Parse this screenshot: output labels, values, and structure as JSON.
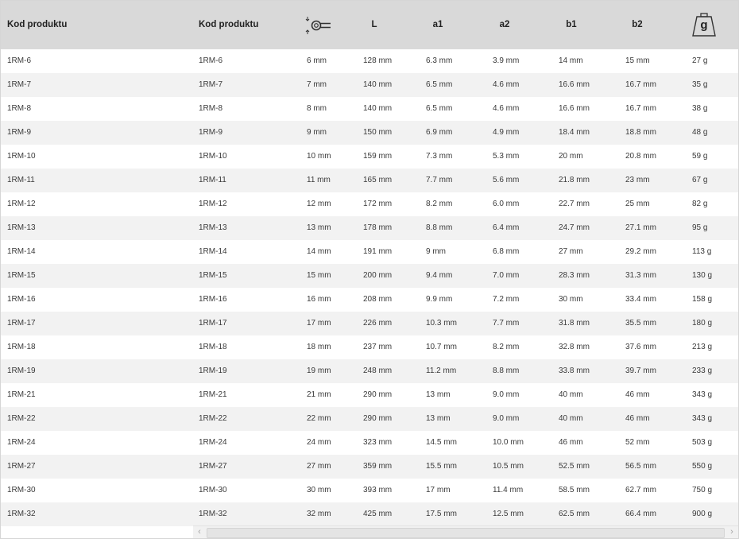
{
  "table": {
    "headers": {
      "code": "Kod produktu",
      "code2": "Kod produktu",
      "size_icon": "wrench-size-icon",
      "L": "L",
      "a1": "a1",
      "a2": "a2",
      "b1": "b1",
      "b2": "b2",
      "weight_icon": "weight-icon",
      "weight_letter": "g"
    },
    "rows": [
      [
        "1RM-6",
        "1RM-6",
        "6 mm",
        "128 mm",
        "6.3 mm",
        "3.9 mm",
        "14 mm",
        "15 mm",
        "27 g"
      ],
      [
        "1RM-7",
        "1RM-7",
        "7 mm",
        "140 mm",
        "6.5 mm",
        "4.6 mm",
        "16.6 mm",
        "16.7 mm",
        "35 g"
      ],
      [
        "1RM-8",
        "1RM-8",
        "8 mm",
        "140 mm",
        "6.5 mm",
        "4.6 mm",
        "16.6 mm",
        "16.7 mm",
        "38 g"
      ],
      [
        "1RM-9",
        "1RM-9",
        "9 mm",
        "150 mm",
        "6.9 mm",
        "4.9 mm",
        "18.4 mm",
        "18.8 mm",
        "48 g"
      ],
      [
        "1RM-10",
        "1RM-10",
        "10 mm",
        "159 mm",
        "7.3 mm",
        "5.3 mm",
        "20 mm",
        "20.8 mm",
        "59 g"
      ],
      [
        "1RM-11",
        "1RM-11",
        "11 mm",
        "165 mm",
        "7.7 mm",
        "5.6 mm",
        "21.8 mm",
        "23 mm",
        "67 g"
      ],
      [
        "1RM-12",
        "1RM-12",
        "12 mm",
        "172 mm",
        "8.2 mm",
        "6.0 mm",
        "22.7 mm",
        "25 mm",
        "82 g"
      ],
      [
        "1RM-13",
        "1RM-13",
        "13 mm",
        "178 mm",
        "8.8 mm",
        "6.4 mm",
        "24.7 mm",
        "27.1 mm",
        "95 g"
      ],
      [
        "1RM-14",
        "1RM-14",
        "14 mm",
        "191 mm",
        "9 mm",
        "6.8 mm",
        "27 mm",
        "29.2 mm",
        "113 g"
      ],
      [
        "1RM-15",
        "1RM-15",
        "15 mm",
        "200 mm",
        "9.4 mm",
        "7.0 mm",
        "28.3 mm",
        "31.3 mm",
        "130 g"
      ],
      [
        "1RM-16",
        "1RM-16",
        "16 mm",
        "208 mm",
        "9.9 mm",
        "7.2 mm",
        "30 mm",
        "33.4 mm",
        "158 g"
      ],
      [
        "1RM-17",
        "1RM-17",
        "17 mm",
        "226 mm",
        "10.3 mm",
        "7.7 mm",
        "31.8 mm",
        "35.5 mm",
        "180 g"
      ],
      [
        "1RM-18",
        "1RM-18",
        "18 mm",
        "237 mm",
        "10.7 mm",
        "8.2 mm",
        "32.8 mm",
        "37.6 mm",
        "213 g"
      ],
      [
        "1RM-19",
        "1RM-19",
        "19 mm",
        "248 mm",
        "11.2 mm",
        "8.8 mm",
        "33.8 mm",
        "39.7 mm",
        "233 g"
      ],
      [
        "1RM-21",
        "1RM-21",
        "21 mm",
        "290 mm",
        "13 mm",
        "9.0 mm",
        "40 mm",
        "46 mm",
        "343 g"
      ],
      [
        "1RM-22",
        "1RM-22",
        "22 mm",
        "290 mm",
        "13 mm",
        "9.0 mm",
        "40 mm",
        "46 mm",
        "343 g"
      ],
      [
        "1RM-24",
        "1RM-24",
        "24 mm",
        "323 mm",
        "14.5 mm",
        "10.0 mm",
        "46 mm",
        "52 mm",
        "503 g"
      ],
      [
        "1RM-27",
        "1RM-27",
        "27 mm",
        "359 mm",
        "15.5 mm",
        "10.5 mm",
        "52.5 mm",
        "56.5 mm",
        "550 g"
      ],
      [
        "1RM-30",
        "1RM-30",
        "30 mm",
        "393 mm",
        "17 mm",
        "11.4 mm",
        "58.5 mm",
        "62.7 mm",
        "750 g"
      ],
      [
        "1RM-32",
        "1RM-32",
        "32 mm",
        "425 mm",
        "17.5 mm",
        "12.5 mm",
        "62.5 mm",
        "66.4 mm",
        "900 g"
      ]
    ]
  },
  "scrollbar": {
    "left_arrow": "‹",
    "right_arrow": "›"
  }
}
